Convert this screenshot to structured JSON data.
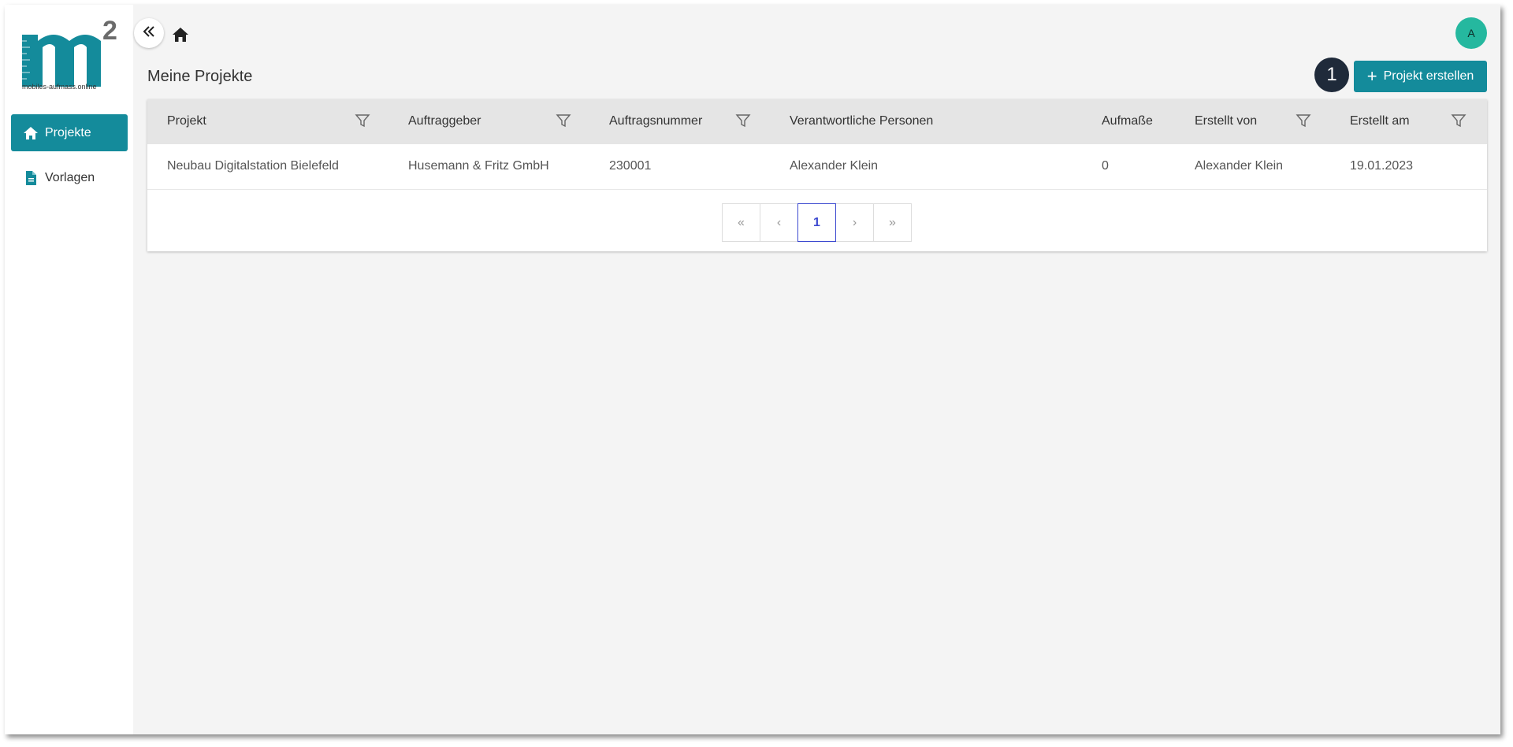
{
  "brand": {
    "logo_text": "m",
    "logo_sup": "2",
    "logo_subtitle": "mobiles-aufmass.online",
    "accent": "#148b9b"
  },
  "sidebar": {
    "items": [
      {
        "label": "Projekte",
        "icon": "home-icon",
        "active": true
      },
      {
        "label": "Vorlagen",
        "icon": "document-icon",
        "active": false
      }
    ]
  },
  "header": {
    "avatar_initial": "A",
    "avatar_color": "#25b89f"
  },
  "main": {
    "title": "Meine Projekte",
    "step_badge": "1",
    "create_button_label": "Projekt erstellen"
  },
  "table": {
    "columns": [
      {
        "label": "Projekt",
        "filter": true
      },
      {
        "label": "Auftraggeber",
        "filter": true
      },
      {
        "label": "Auftragsnummer",
        "filter": true
      },
      {
        "label": "Verantwortliche Personen",
        "filter": false
      },
      {
        "label": "Aufmaße",
        "filter": false
      },
      {
        "label": "Erstellt von",
        "filter": true
      },
      {
        "label": "Erstellt am",
        "filter": true
      }
    ],
    "rows": [
      [
        "Neubau Digitalstation Bielefeld",
        "Husemann & Fritz GmbH",
        "230001",
        "Alexander Klein",
        "0",
        "Alexander Klein",
        "19.01.2023"
      ]
    ]
  },
  "pagination": {
    "first": "«",
    "prev": "‹",
    "current": "1",
    "next": "›",
    "last": "»"
  }
}
